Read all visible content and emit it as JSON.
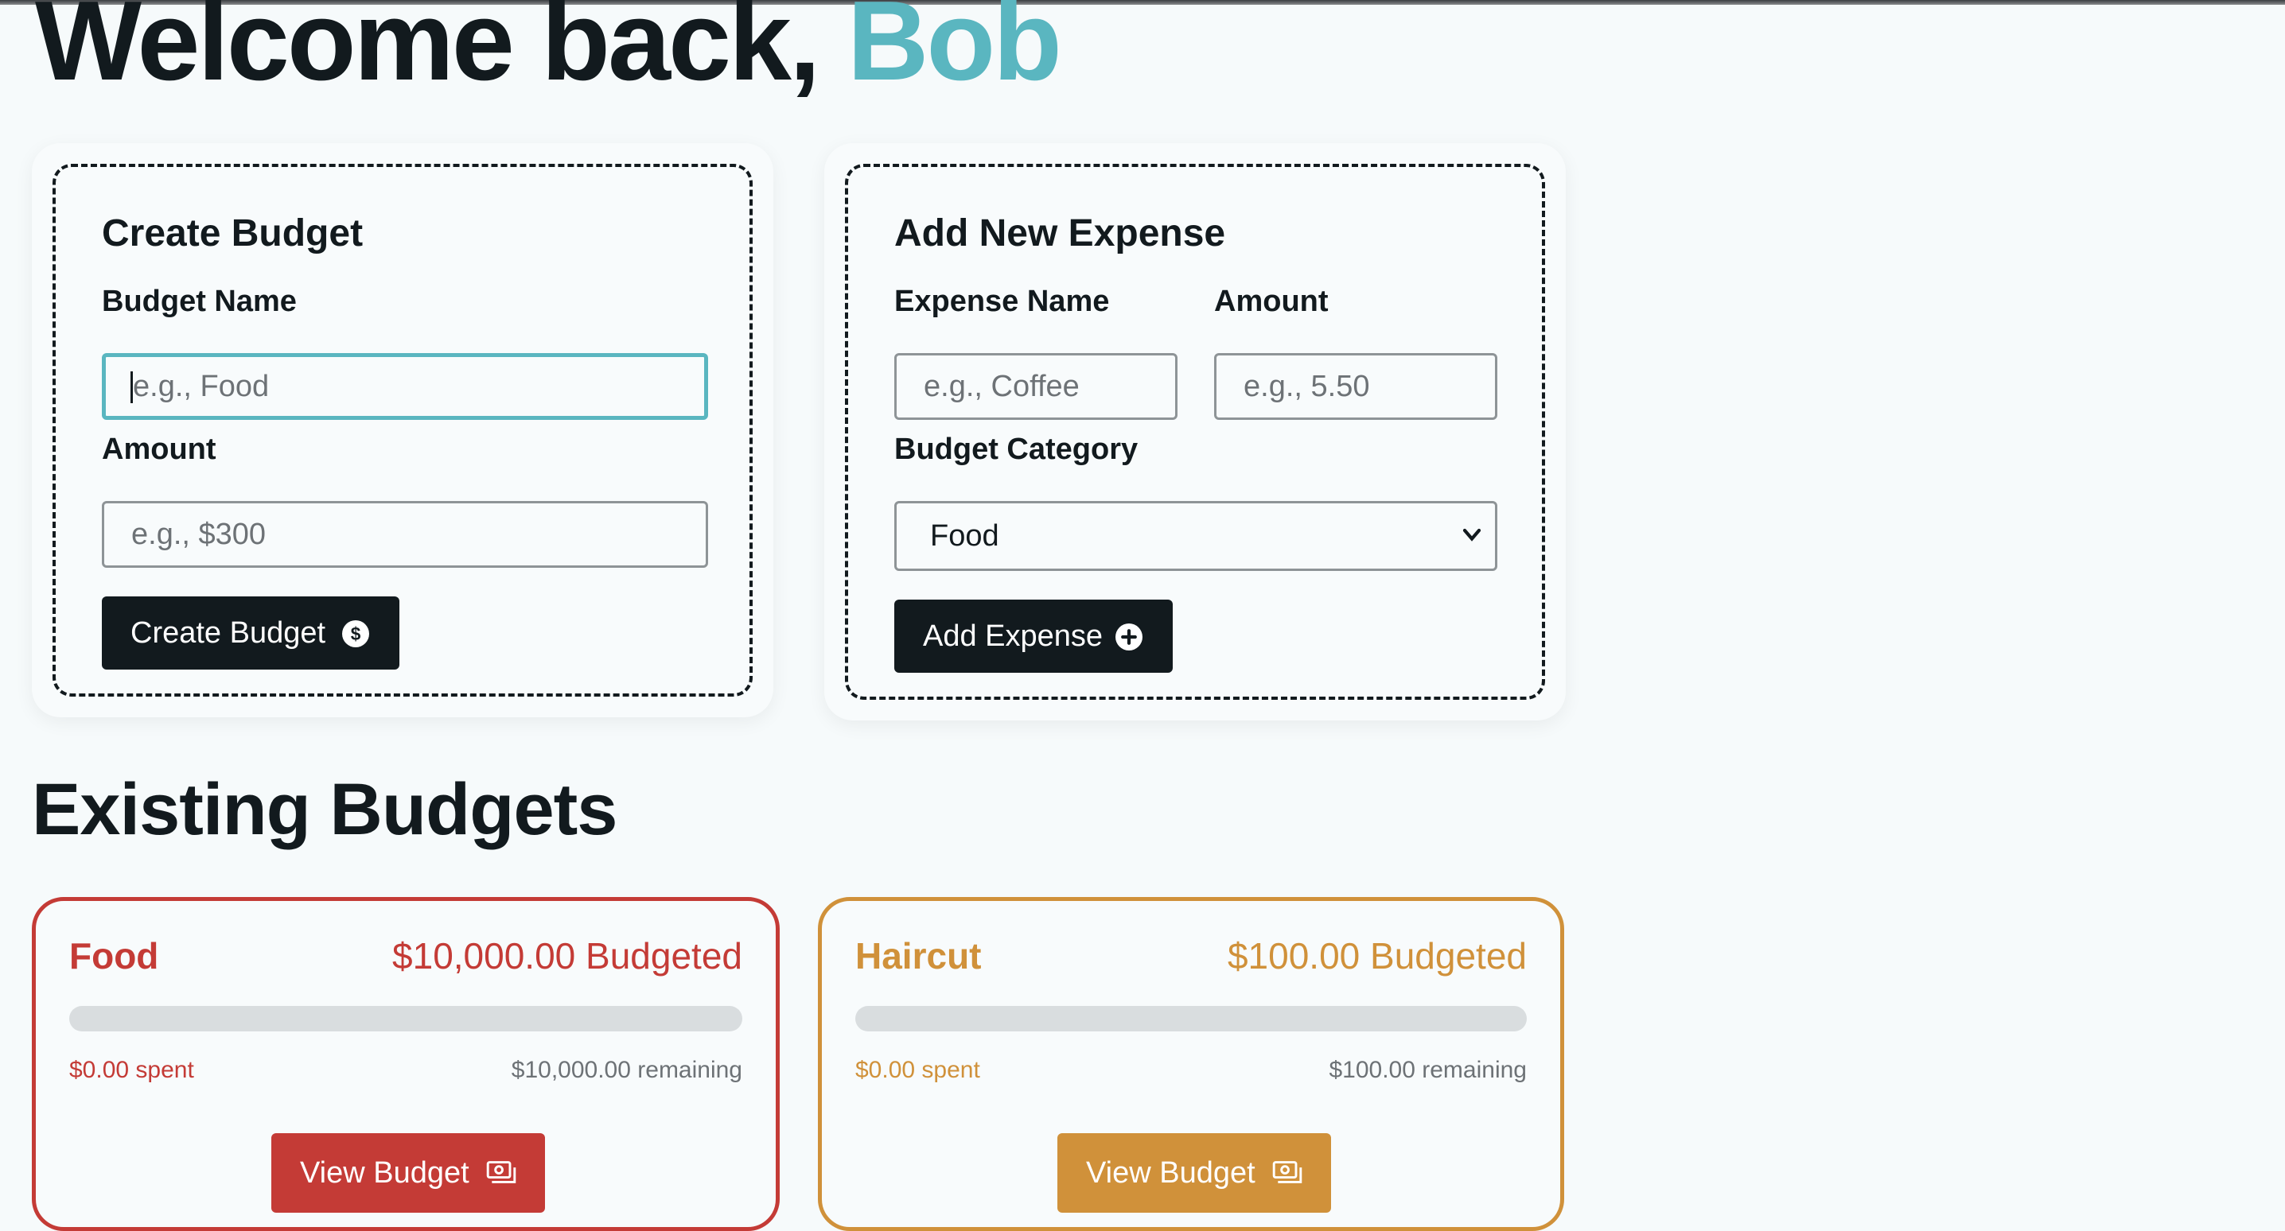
{
  "header": {
    "greeting": "Welcome back,",
    "username": "Bob"
  },
  "colors": {
    "accent": "#5ab6c0",
    "dark": "#121a1e",
    "food": "#c43b36",
    "haircut": "#d0913a"
  },
  "create_budget": {
    "title": "Create Budget",
    "name_label": "Budget Name",
    "name_placeholder": "e.g., Food",
    "name_value": "",
    "amount_label": "Amount",
    "amount_placeholder": "e.g., $300",
    "amount_value": "",
    "button_label": "Create Budget",
    "button_icon": "currency-dollar-circle-icon"
  },
  "add_expense": {
    "title": "Add New Expense",
    "name_label": "Expense Name",
    "name_placeholder": "e.g., Coffee",
    "name_value": "",
    "amount_label": "Amount",
    "amount_placeholder": "e.g., 5.50",
    "amount_value": "",
    "category_label": "Budget Category",
    "category_selected": "Food",
    "button_label": "Add Expense",
    "button_icon": "plus-circle-icon"
  },
  "existing": {
    "title": "Existing Budgets",
    "budgets": [
      {
        "name": "Food",
        "budgeted": "$10,000.00 Budgeted",
        "spent": "$0.00 spent",
        "remaining": "$10,000.00 remaining",
        "progress": 0,
        "color": "#c43b36",
        "button_label": "View Budget",
        "button_icon": "banknotes-icon"
      },
      {
        "name": "Haircut",
        "budgeted": "$100.00 Budgeted",
        "spent": "$0.00 spent",
        "remaining": "$100.00 remaining",
        "progress": 0,
        "color": "#d0913a",
        "button_label": "View Budget",
        "button_icon": "banknotes-icon"
      }
    ]
  }
}
